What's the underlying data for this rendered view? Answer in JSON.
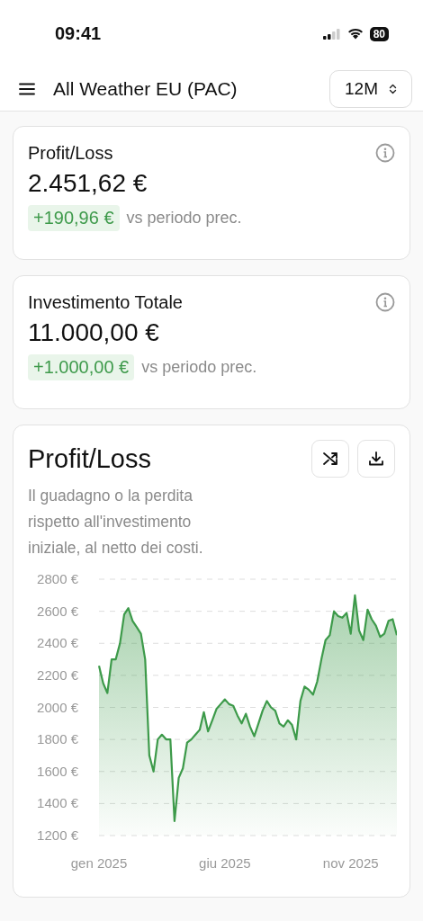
{
  "status_bar": {
    "time": "09:41",
    "battery": "80"
  },
  "nav": {
    "title": "All Weather EU (PAC)",
    "period": "12M"
  },
  "kpis": [
    {
      "title": "Profit/Loss",
      "value": "2.451,62 €",
      "delta": "+190,96 €",
      "compare": "vs periodo prec."
    },
    {
      "title": "Investimento Totale",
      "value": "11.000,00 €",
      "delta": "+1.000,00 €",
      "compare": "vs periodo prec."
    }
  ],
  "chart_card": {
    "title": "Profit/Loss",
    "description": "Il guadagno o la perdita rispetto all'investimento iniziale, al netto dei costi.",
    "chart_data": {
      "type": "area",
      "categories": [
        "gen 2025",
        null,
        null,
        null,
        null,
        null,
        null,
        null,
        null,
        null,
        null,
        null,
        null,
        null,
        null,
        null,
        null,
        null,
        null,
        null,
        null,
        null,
        null,
        null,
        null,
        null,
        null,
        null,
        null,
        null,
        "giu 2025",
        null,
        null,
        null,
        null,
        null,
        null,
        null,
        null,
        null,
        null,
        null,
        null,
        null,
        null,
        null,
        null,
        null,
        null,
        null,
        null,
        null,
        null,
        null,
        null,
        null,
        null,
        null,
        null,
        null,
        "nov 2025",
        null,
        null,
        null,
        null,
        null,
        null,
        null,
        null,
        null,
        null,
        null
      ],
      "series": [
        {
          "color": "#3d9a4a",
          "values": [
            2260,
            2150,
            2090,
            2300,
            2300,
            2400,
            2580,
            2620,
            2540,
            2500,
            2460,
            2300,
            1700,
            1600,
            1800,
            1830,
            1800,
            1800,
            1290,
            1560,
            1620,
            1780,
            1800,
            1830,
            1860,
            1970,
            1850,
            1920,
            1990,
            2020,
            2050,
            2020,
            2010,
            1950,
            1900,
            1960,
            1880,
            1820,
            1900,
            1980,
            2040,
            2000,
            1980,
            1900,
            1880,
            1920,
            1890,
            1800,
            2040,
            2130,
            2110,
            2080,
            2160,
            2300,
            2420,
            2450,
            2600,
            2570,
            2560,
            2590,
            2460,
            2700,
            2480,
            2420,
            2610,
            2550,
            2510,
            2440,
            2460,
            2540,
            2550,
            2450
          ]
        }
      ],
      "ylim": [
        1200,
        2800
      ],
      "grid": true,
      "yticks": [
        {
          "value": 2800,
          "label": "2800 €"
        },
        {
          "value": 2600,
          "label": "2600 €"
        },
        {
          "value": 2400,
          "label": "2400 €"
        },
        {
          "value": 2200,
          "label": "2200 €"
        },
        {
          "value": 2000,
          "label": "2000 €"
        },
        {
          "value": 1800,
          "label": "1800 €"
        },
        {
          "value": 1600,
          "label": "1600 €"
        },
        {
          "value": 1400,
          "label": "1400 €"
        },
        {
          "value": 1200,
          "label": "1200 €"
        }
      ]
    }
  }
}
